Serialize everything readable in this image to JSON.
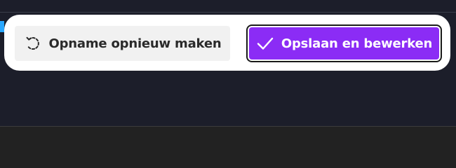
{
  "toolbar": {
    "retake_label": "Opname opnieuw maken",
    "save_label": "Opslaan en bewerken",
    "retake_icon": "redo-dashed-circle-icon",
    "save_icon": "checkmark-icon"
  },
  "colors": {
    "background": "#1c1e2a",
    "toolbar_bg": "#ffffff",
    "retake_bg": "#f1f1f1",
    "accent": "#8b2cf5",
    "accent_text": "#ffffff"
  }
}
